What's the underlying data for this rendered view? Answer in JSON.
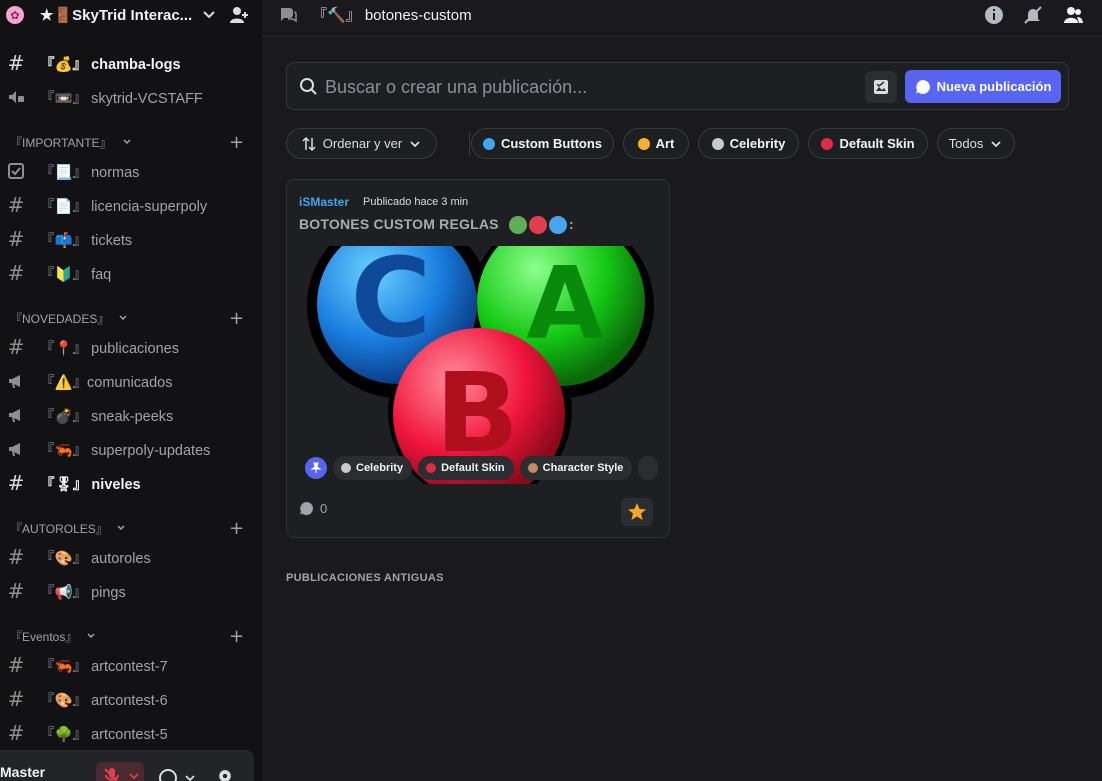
{
  "server": {
    "name": "★🚪SkyTrid Interac...",
    "icon": "server-icon"
  },
  "channels": [
    {
      "icon": "hash",
      "name": "『💰』 chamba-logs",
      "bold": true
    },
    {
      "icon": "speaker",
      "name": "『📼』 skytrid-VCSTAFF",
      "bold": false
    }
  ],
  "categories": {
    "importante": {
      "label": "『IMPORTANTE』",
      "channels": [
        {
          "icon": "rules",
          "name": "『📃』 normas"
        },
        {
          "icon": "hash",
          "name": "『📄』 licencia-superpoly"
        },
        {
          "icon": "hash",
          "name": "『📫』 tickets"
        },
        {
          "icon": "hash",
          "name": "『🔰』 faq"
        }
      ]
    },
    "novedades": {
      "label": "『NOVEDADES』",
      "channels": [
        {
          "icon": "hash",
          "name": "『📍』 publicaciones",
          "bold": false
        },
        {
          "icon": "megaphone",
          "name": "『⚠️』comunicados",
          "bold": false
        },
        {
          "icon": "megaphone",
          "name": "『💣』 sneak-peeks",
          "bold": false
        },
        {
          "icon": "megaphone",
          "name": "『🦐』 superpoly-updates",
          "bold": false
        },
        {
          "icon": "hash",
          "name": "『🎖』 niveles",
          "bold": true
        }
      ]
    },
    "autoroles": {
      "label": "『AUTOROLES』",
      "channels": [
        {
          "icon": "hash",
          "name": "『🎨』 autoroles"
        },
        {
          "icon": "hash",
          "name": "『📢』 pings"
        }
      ]
    },
    "eventos": {
      "label": "『Eventos』",
      "channels": [
        {
          "icon": "hash",
          "name": "『🦐』 artcontest-7"
        },
        {
          "icon": "hash",
          "name": "『🎨』 artcontest-6"
        },
        {
          "icon": "hash",
          "name": "『🌳』 artcontest-5"
        }
      ]
    }
  },
  "user_panel": {
    "name": "Master"
  },
  "topbar": {
    "title": "『🔨』 botones-custom"
  },
  "search": {
    "placeholder": "Buscar o crear una publicación..."
  },
  "new_post_label": "Nueva publicación",
  "filters": {
    "sort_label": "Ordenar y ver",
    "tags": [
      {
        "name": "Custom Buttons",
        "color": "#3ba8f0"
      },
      {
        "name": "Art",
        "color": "#f0b232"
      },
      {
        "name": "Celebrity",
        "color": "#c9c9c9"
      },
      {
        "name": "Default Skin",
        "color": "#e02b45"
      }
    ],
    "all_label": "Todos"
  },
  "post": {
    "author": "iSMaster",
    "time": "Publicado hace 3 min",
    "title": "BOTONES CUSTOM REGLAS",
    "title_suffix": ":",
    "title_dot_colors": [
      "#5fae5a",
      "#e0404e",
      "#4aa3f0"
    ],
    "image_letters": [
      "C",
      "A",
      "B"
    ],
    "tags": [
      "Celebrity",
      "Default Skin",
      "Character Style"
    ],
    "comment_count": "0"
  },
  "older_posts_label": "PUBLICACIONES ANTIGUAS",
  "colors": {
    "accent": "#5865f2",
    "author": "#3ba8f0",
    "sidebar_bg": "#121214",
    "main_bg": "#1a1a1e"
  }
}
